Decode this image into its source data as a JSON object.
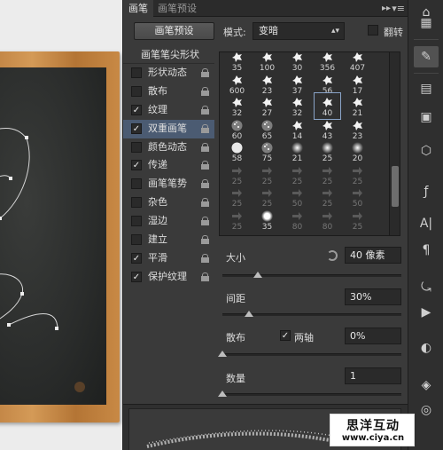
{
  "tabs": [
    {
      "label": "画笔",
      "active": true
    },
    {
      "label": "画笔预设",
      "active": false
    }
  ],
  "tab_more": "▸▸",
  "tab_menu": "▾≡",
  "header": {
    "preset_button": "画笔预设",
    "mode_label": "模式:",
    "mode_value": "变暗",
    "flip_label": "翻转",
    "flip_checked": false
  },
  "options": {
    "header": "画笔笔尖形状",
    "items": [
      {
        "label": "形状动态",
        "checked": false,
        "selected": false
      },
      {
        "label": "散布",
        "checked": false,
        "selected": false
      },
      {
        "label": "纹理",
        "checked": true,
        "selected": false
      },
      {
        "label": "双重画笔",
        "checked": true,
        "selected": true
      },
      {
        "label": "颜色动态",
        "checked": false,
        "selected": false
      },
      {
        "label": "传递",
        "checked": true,
        "selected": false
      },
      {
        "label": "画笔笔势",
        "checked": false,
        "selected": false
      },
      {
        "label": "杂色",
        "checked": false,
        "selected": false
      },
      {
        "label": "湿边",
        "checked": false,
        "selected": false
      },
      {
        "label": "建立",
        "checked": false,
        "selected": false
      },
      {
        "label": "平滑",
        "checked": true,
        "selected": false
      },
      {
        "label": "保护纹理",
        "checked": true,
        "selected": false
      }
    ]
  },
  "brush_grid": {
    "rows": [
      [
        {
          "n": "35",
          "k": "splat"
        },
        {
          "n": "100",
          "k": "splat"
        },
        {
          "n": "30",
          "k": "splat"
        },
        {
          "n": "356",
          "k": "splat"
        },
        {
          "n": "407",
          "k": "splat"
        }
      ],
      [
        {
          "n": "600",
          "k": "splat"
        },
        {
          "n": "23",
          "k": "splat"
        },
        {
          "n": "37",
          "k": "splat"
        },
        {
          "n": "56",
          "k": "splat"
        },
        {
          "n": "17",
          "k": "splat"
        }
      ],
      [
        {
          "n": "32",
          "k": "splat"
        },
        {
          "n": "27",
          "k": "splat"
        },
        {
          "n": "32",
          "k": "splat"
        },
        {
          "n": "40",
          "k": "splat",
          "sel": true
        },
        {
          "n": "21",
          "k": "splat"
        }
      ],
      [
        {
          "n": "60",
          "k": "speckle"
        },
        {
          "n": "65",
          "k": "speckle"
        },
        {
          "n": "14",
          "k": "splat"
        },
        {
          "n": "43",
          "k": "splat"
        },
        {
          "n": "23",
          "k": "splat"
        }
      ],
      [
        {
          "n": "58",
          "k": "round"
        },
        {
          "n": "75",
          "k": "speckle"
        },
        {
          "n": "21",
          "k": "soft"
        },
        {
          "n": "25",
          "k": "soft"
        },
        {
          "n": "20",
          "k": "soft"
        }
      ],
      [
        {
          "n": "25",
          "k": "arrow",
          "dim": true
        },
        {
          "n": "25",
          "k": "arrow",
          "dim": true
        },
        {
          "n": "25",
          "k": "arrow",
          "dim": true
        },
        {
          "n": "25",
          "k": "arrow",
          "dim": true
        },
        {
          "n": "25",
          "k": "arrow",
          "dim": true
        }
      ],
      [
        {
          "n": "25",
          "k": "arrow",
          "dim": true
        },
        {
          "n": "25",
          "k": "arrow",
          "dim": true
        },
        {
          "n": "50",
          "k": "arrow",
          "dim": true
        },
        {
          "n": "25",
          "k": "arrow",
          "dim": true
        },
        {
          "n": "50",
          "k": "arrow",
          "dim": true
        }
      ],
      [
        {
          "n": "25",
          "k": "arrow",
          "dim": true
        },
        {
          "n": "35",
          "k": "glow"
        },
        {
          "n": "80",
          "k": "arrow",
          "dim": true
        },
        {
          "n": "80",
          "k": "arrow",
          "dim": true
        },
        {
          "n": "25",
          "k": "arrow",
          "dim": true
        }
      ]
    ]
  },
  "controls": {
    "size_label": "大小",
    "size_value": "40 像素",
    "size_slider": 0.2,
    "spacing_label": "间距",
    "spacing_value": "30%",
    "spacing_slider": 0.15,
    "scatter_label": "散布",
    "both_axes_label": "两轴",
    "both_axes_checked": true,
    "scatter_value": "0%",
    "scatter_slider": 0.0,
    "count_label": "数量",
    "count_value": "1",
    "count_slider": 0.0
  },
  "watermark": {
    "title": "思洋互动",
    "url": "www.ciya.cn"
  }
}
